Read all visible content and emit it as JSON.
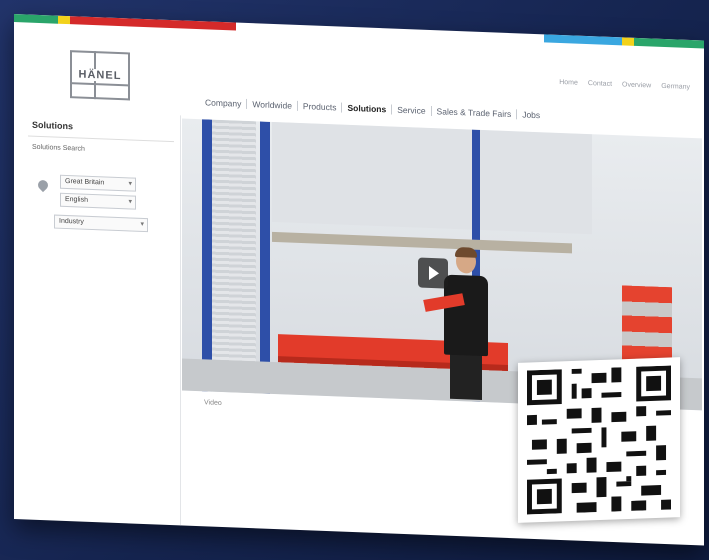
{
  "brand": {
    "logo_text": "HÄNEL"
  },
  "utility_links": [
    "Home",
    "Contact",
    "Overview",
    "Germany"
  ],
  "nav": {
    "items": [
      "Company",
      "Worldwide",
      "Products",
      "Solutions",
      "Service",
      "Sales & Trade Fairs",
      "Jobs"
    ],
    "active": "Solutions"
  },
  "sidebar": {
    "title": "Solutions",
    "link": "Solutions Search",
    "country_select": "Great Britain",
    "language_select": "English",
    "extra_select": "Industry"
  },
  "video": {
    "caption": "Video"
  },
  "colors": {
    "stripe_green": "#2aa56a",
    "stripe_red": "#d42a2a",
    "stripe_blue": "#3aa7e0",
    "stripe_yellow": "#f2d21b",
    "post_blue": "#2e4fa8",
    "bin_red": "#e23b2a"
  }
}
